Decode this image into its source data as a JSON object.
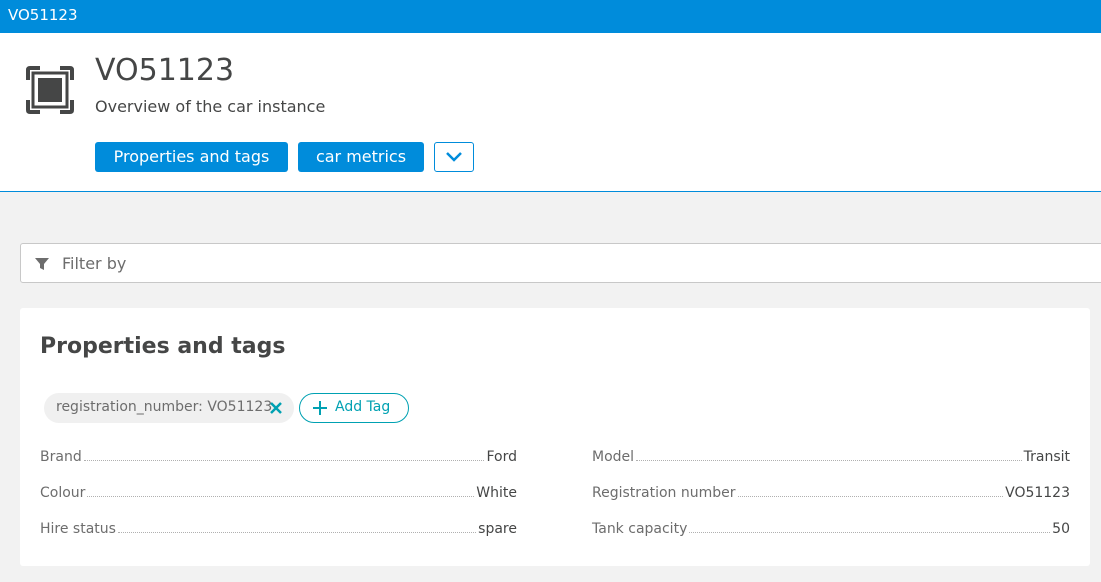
{
  "topbar": {
    "title": "VO51123"
  },
  "header": {
    "entity_name": "VO51123",
    "subtitle": "Overview of the car instance",
    "tabs": [
      {
        "label": "Properties and tags"
      },
      {
        "label": "car metrics"
      }
    ],
    "more_icon": "chevron-down-icon",
    "entity_icon": "instance-frame-icon"
  },
  "filter": {
    "placeholder": "Filter by",
    "icon": "filter-icon"
  },
  "properties_card": {
    "title": "Properties and tags",
    "tags": [
      {
        "label": "registration_number: VO51123"
      }
    ],
    "add_tag_label": "Add Tag",
    "left": [
      {
        "key": "Brand",
        "value": "Ford"
      },
      {
        "key": "Colour",
        "value": "White"
      },
      {
        "key": "Hire status",
        "value": "spare"
      }
    ],
    "right": [
      {
        "key": "Model",
        "value": "Transit"
      },
      {
        "key": "Registration number",
        "value": "VO51123"
      },
      {
        "key": "Tank capacity",
        "value": "50"
      }
    ]
  },
  "colors": {
    "accent": "#008cdb",
    "tag_accent": "#00a1b2",
    "text": "#454646",
    "background": "#f2f2f2"
  }
}
